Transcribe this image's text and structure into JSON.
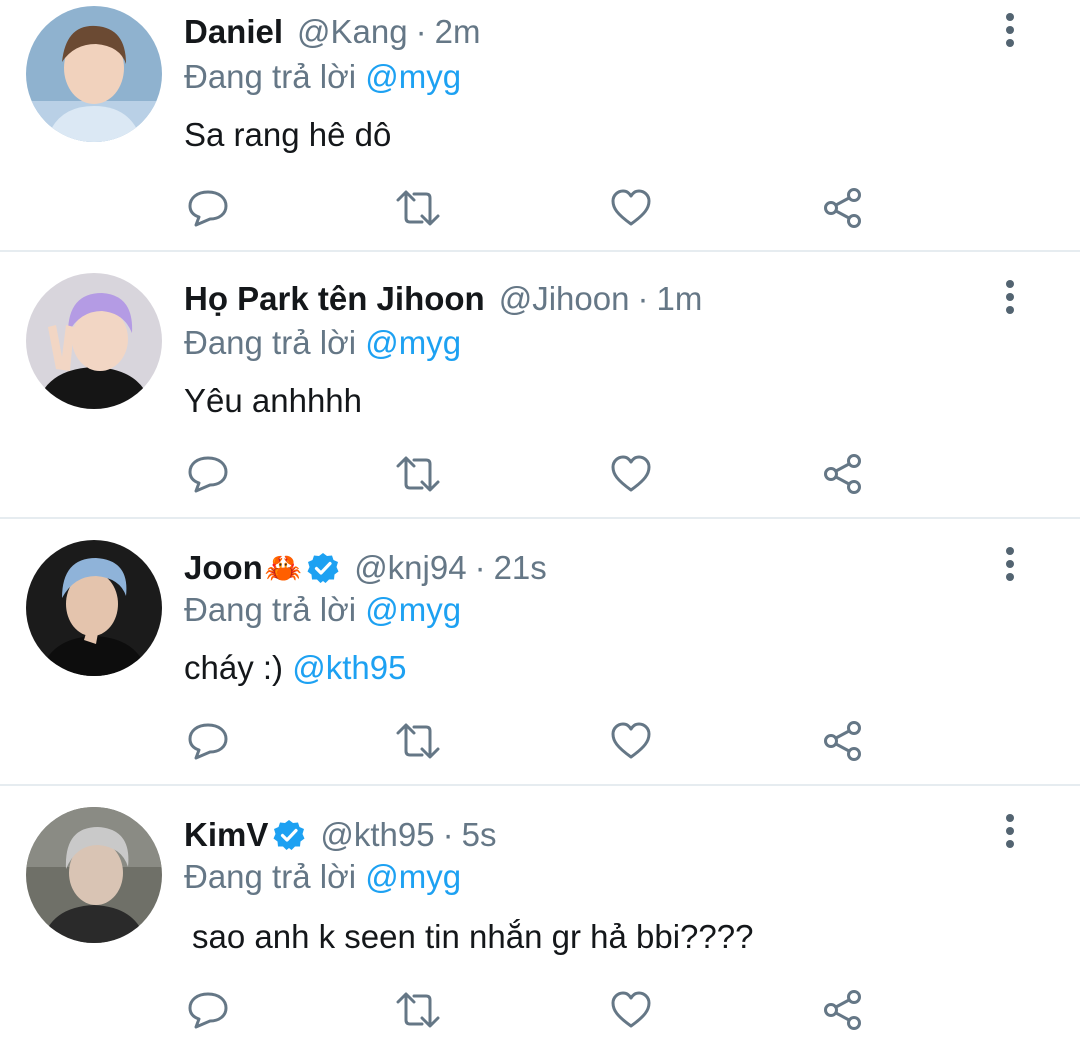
{
  "tweets": [
    {
      "name": "Daniel",
      "handle": "@Kang",
      "separator": "·",
      "time": "2m",
      "reply_prefix": "Đang trả lời",
      "reply_to": "@myg",
      "text": "Sa rang hê dô",
      "text_mention": "",
      "verified": false,
      "emoji": ""
    },
    {
      "name": "Họ Park tên Jihoon",
      "handle": "@Jihoon",
      "separator": "·",
      "time": "1m",
      "reply_prefix": "Đang trả lời",
      "reply_to": "@myg",
      "text": "Yêu anhhhh",
      "text_mention": "",
      "verified": false,
      "emoji": ""
    },
    {
      "name": "Joon",
      "handle": "@knj94",
      "separator": "·",
      "time": "21s",
      "reply_prefix": "Đang trả lời",
      "reply_to": "@myg",
      "text": "cháy :)",
      "text_mention": "@kth95",
      "verified": true,
      "emoji": "🦀"
    },
    {
      "name": "KimV",
      "handle": "@kth95",
      "separator": "·",
      "time": "5s",
      "reply_prefix": "Đang trả lời",
      "reply_to": "@myg",
      "text": "sao anh k seen tin nhắn gr hả bbi????",
      "text_mention": "",
      "verified": true,
      "emoji": ""
    }
  ],
  "icons": {
    "reply": "speech-bubble-icon",
    "retweet": "retweet-icon",
    "like": "heart-icon",
    "share": "share-icon",
    "more": "vertical-dots-icon",
    "verified": "verified-badge-icon"
  },
  "colors": {
    "link": "#1da1f2",
    "muted": "#657786",
    "text": "#14171a",
    "divider": "#e6ecf0"
  }
}
